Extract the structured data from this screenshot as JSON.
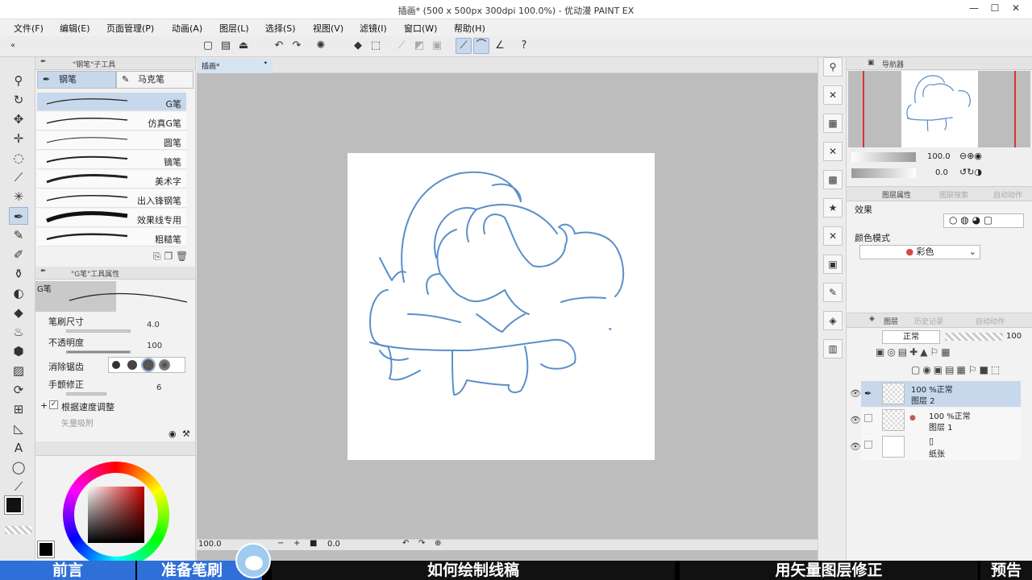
{
  "window": {
    "title": "插画* (500 x 500px 300dpi 100.0%) - 优动漫 PAINT EX",
    "controls": [
      "—",
      "☐",
      "✕"
    ]
  },
  "menu": [
    "文件(F)",
    "编辑(E)",
    "页面管理(P)",
    "动画(A)",
    "图层(L)",
    "选择(S)",
    "视图(V)",
    "滤镜(I)",
    "窗口(W)",
    "帮助(H)"
  ],
  "subtool_panel": {
    "header": "\"钢笔\"子工具",
    "tabs": [
      "钢笔",
      "马克笔"
    ],
    "brushes": [
      "G笔",
      "仿真G笔",
      "圆笔",
      "镝笔",
      "美术字",
      "出入锋钢笔",
      "效果线专用",
      "粗糙笔"
    ]
  },
  "tool_property": {
    "header": "\"G笔\"工具属性",
    "preset_name": "G笔",
    "rows": {
      "size_label": "笔刷尺寸",
      "size_value": "4.0",
      "opacity_label": "不透明度",
      "opacity_value": "100",
      "antialias_label": "消除锯齿",
      "stabilize_label": "手颤修正",
      "stabilize_value": "6",
      "speed_label": "根据速度调整",
      "vector_label": "矢量吸附"
    }
  },
  "canvas": {
    "doc_tab": "插画*",
    "status": {
      "zoom": "100.0",
      "angle": "0.0"
    }
  },
  "navigator": {
    "tab": "导航器",
    "zoom": "100.0",
    "rotate": "0.0"
  },
  "layer_property": {
    "tabs": [
      "图层属性",
      "图层搜索",
      "自动动作"
    ],
    "effect_label": "效果",
    "color_mode_label": "颜色模式",
    "color_mode_value": "彩色"
  },
  "layers_panel": {
    "tabs": [
      "图层",
      "历史记录",
      "自动动作"
    ],
    "blend_mode": "正常",
    "opacity": "100",
    "layers": [
      {
        "opacity": "100 %正常",
        "name": "图层 2",
        "selected": true
      },
      {
        "opacity": "100 %正常",
        "name": "图层 1",
        "selected": false
      },
      {
        "opacity": "",
        "name": "纸张",
        "selected": false
      }
    ]
  },
  "chapters": [
    "前言",
    "准备笔刷",
    "如何绘制线稿",
    "用矢量图层修正",
    "预告"
  ],
  "colors": {
    "accent": "#c7d8ec",
    "stroke": "#5b8fc9",
    "chapter_active": "#2f6fd8"
  }
}
